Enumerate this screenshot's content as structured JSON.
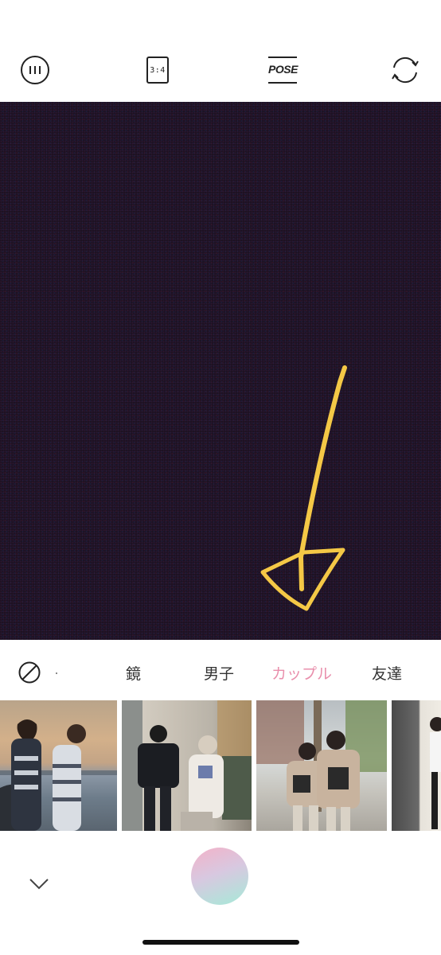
{
  "toolbar": {
    "ratio_label": "3:4",
    "pose_label": "POSE",
    "icons": [
      "menu-icon",
      "ratio-icon",
      "pose-icon",
      "switch-camera-icon"
    ]
  },
  "annotation": {
    "color": "#f4c846"
  },
  "tabs": {
    "none_icon": "no-filter-icon",
    "items": [
      "鏡",
      "男子",
      "カップル",
      "友達"
    ],
    "active_index": 2,
    "active_color": "#e98fac"
  },
  "thumbnails": {
    "count": 4
  },
  "bottom": {
    "collapse_icon": "chevron-down-icon",
    "shutter_colors": [
      "#f3b2c8",
      "#a6ead8"
    ]
  }
}
